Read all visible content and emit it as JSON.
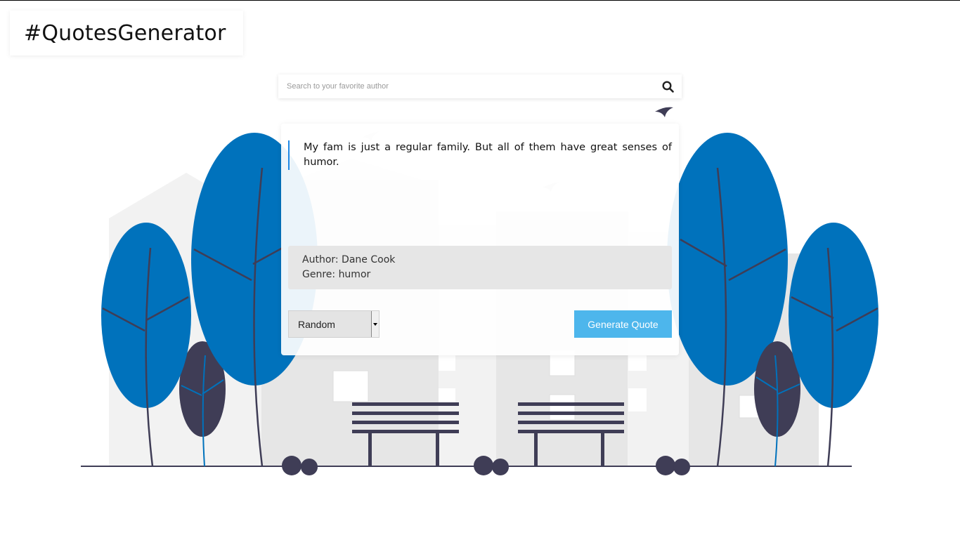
{
  "header": {
    "logo_text": "#QuotesGenerator"
  },
  "search": {
    "placeholder": "Search to your favorite author",
    "value": "",
    "icon": "search-icon"
  },
  "quote": {
    "text": "My fam is just a regular family. But all of them have great senses of humor.",
    "author_line": "Author: Dane Cook",
    "genre_line": "Genre: humor"
  },
  "controls": {
    "mode_selected": "Random",
    "generate_label": "Generate Quote"
  },
  "colors": {
    "accent": "#4db6ec",
    "tree_blue": "#0072bc",
    "dark": "#3f3d56",
    "quote_bar": "#1e88e5"
  }
}
